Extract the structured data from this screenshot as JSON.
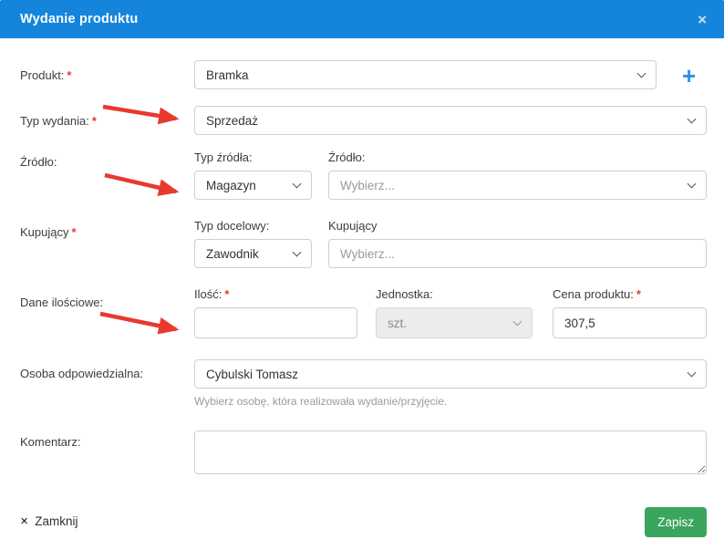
{
  "modal": {
    "title": "Wydanie produktu",
    "close_icon": "×"
  },
  "colors": {
    "header_blue": "#1585db",
    "plus_blue": "#2e8ee8",
    "save_green": "#3aa55d",
    "arrow_red": "#e8392e",
    "required_red": "#e53935"
  },
  "form": {
    "produkt": {
      "label": "Produkt:",
      "required": "*",
      "value": "Bramka"
    },
    "typ_wydania": {
      "label": "Typ wydania:",
      "required": "*",
      "value": "Sprzedaż"
    },
    "zrodlo": {
      "label": "Źródło:",
      "typ_zrodla_label": "Typ źródła:",
      "typ_zrodla_value": "Magazyn",
      "zrodlo_label": "Źródło:",
      "zrodlo_placeholder": "Wybierz..."
    },
    "kupujacy": {
      "label": "Kupujący",
      "required": "*",
      "typ_docelowy_label": "Typ docelowy:",
      "typ_docelowy_value": "Zawodnik",
      "kupujacy_label": "Kupujący",
      "kupujacy_placeholder": "Wybierz..."
    },
    "dane_ilosciowe": {
      "label": "Dane ilościowe:",
      "ilosc_label": "Ilość:",
      "ilosc_required": "*",
      "ilosc_value": "",
      "jednostka_label": "Jednostka:",
      "jednostka_value": "szt.",
      "cena_label": "Cena produktu:",
      "cena_required": "*",
      "cena_value": "307,5"
    },
    "osoba": {
      "label": "Osoba odpowiedzialna:",
      "value": "Cybulski Tomasz",
      "helper": "Wybierz osobę, która realizowała wydanie/przyjęcie."
    },
    "komentarz": {
      "label": "Komentarz:",
      "value": ""
    }
  },
  "footer": {
    "close_icon": "✕",
    "close_label": "Zamknij",
    "save_label": "Zapisz"
  }
}
